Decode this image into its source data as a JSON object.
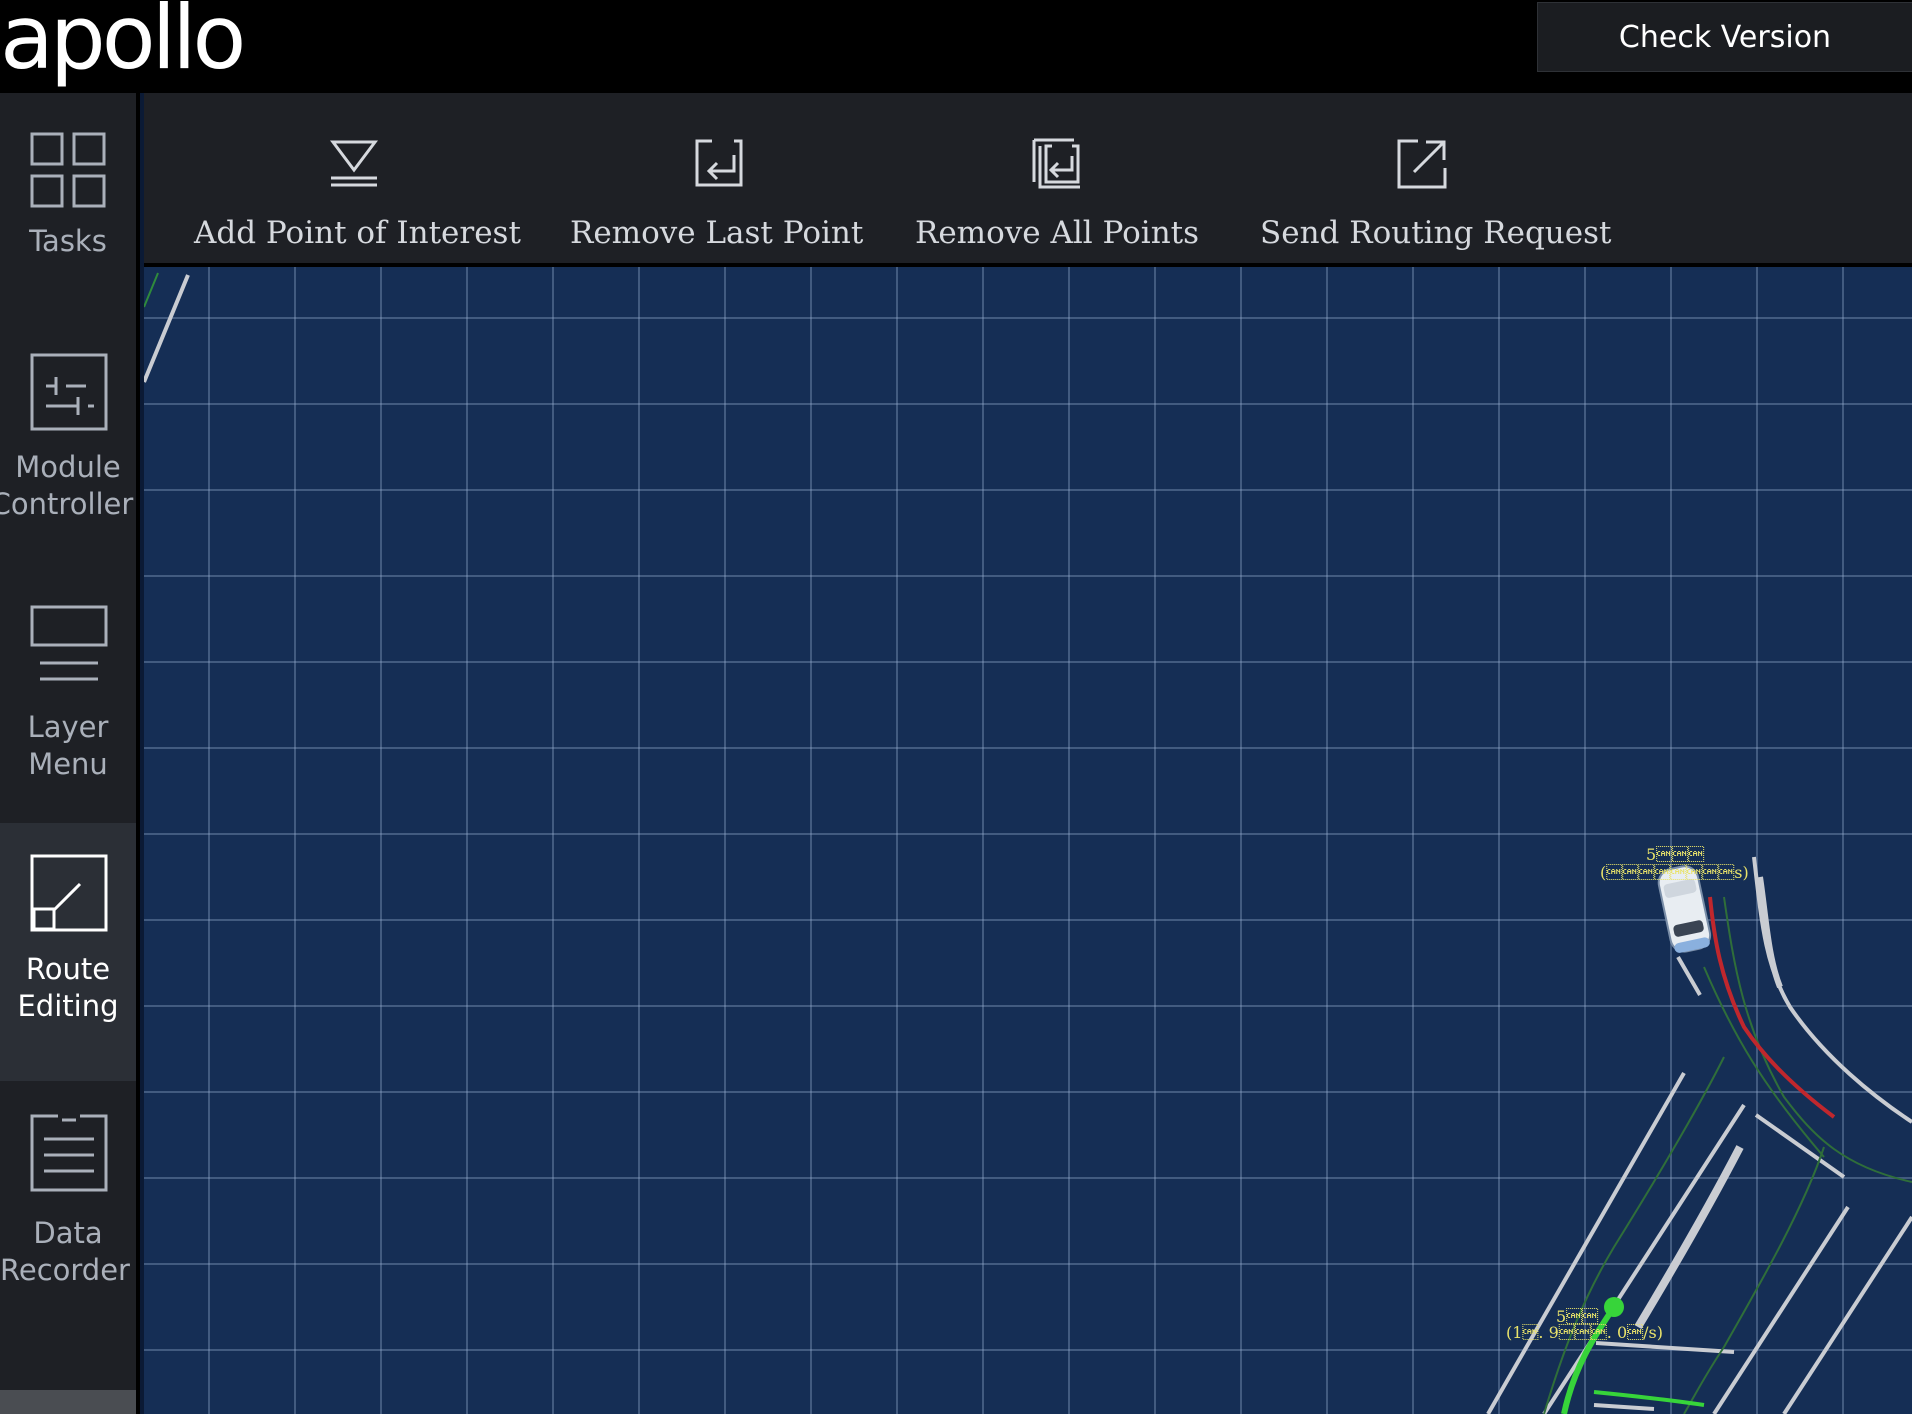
{
  "header": {
    "logo_text": "apollo",
    "check_version_label": "Check Version"
  },
  "sidebar": {
    "items": [
      {
        "label_line1": "Tasks",
        "label_line2": "",
        "icon": "grid-icon"
      },
      {
        "label_line1": "Module",
        "label_line2": "Controller",
        "icon": "controller-icon"
      },
      {
        "label_line1": "Layer",
        "label_line2": "Menu",
        "icon": "layer-icon"
      },
      {
        "label_line1": "Route",
        "label_line2": "Editing",
        "icon": "route-icon",
        "active": true
      },
      {
        "label_line1": "Data",
        "label_line2": "Recorder",
        "icon": "recorder-icon"
      }
    ]
  },
  "toolbar": {
    "tools": [
      {
        "label": "Add Point of Interest",
        "icon": "add-point-icon"
      },
      {
        "label": "Remove Last Point",
        "icon": "remove-last-icon"
      },
      {
        "label": "Remove All Points",
        "icon": "remove-all-icon"
      },
      {
        "label": "Send Routing Request",
        "icon": "send-icon"
      }
    ]
  },
  "map": {
    "ego_label_line1": "5\u0018\u0018\u0018",
    "ego_label_line2": "(\u0018\u0018\u0018\u0018\u0018\u0018\u0018\u0018s)",
    "obstacle_label_line1": "5\u0018\u0018",
    "obstacle_label_line2": "(1\u0018. 9\u0018\u0018\u0018. 0\u0018/s)",
    "colors": {
      "background": "#152e55",
      "lane": "#c9ccd2",
      "route": "#c0272d",
      "obstacle": "#37d43a",
      "label": "#e9e36a"
    }
  }
}
